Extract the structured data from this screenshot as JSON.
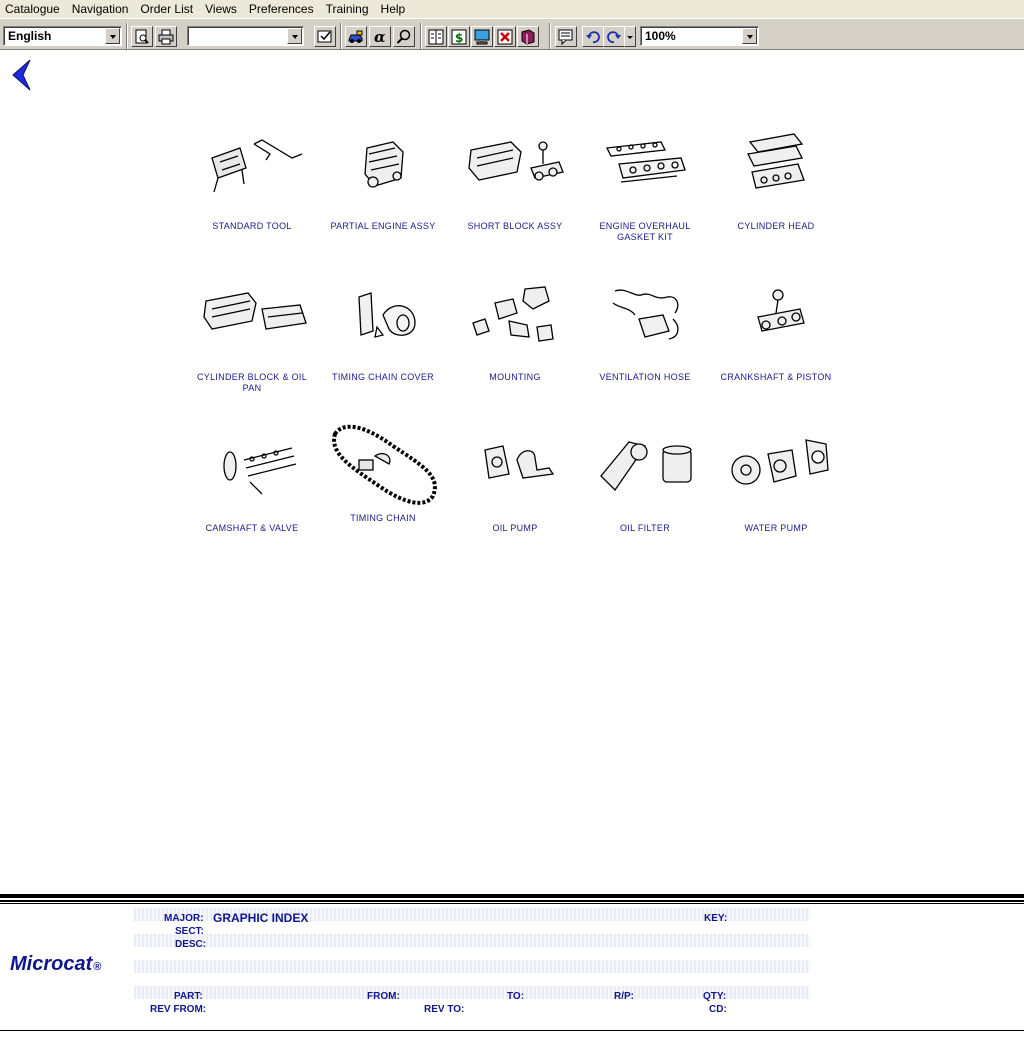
{
  "menu": [
    "Catalogue",
    "Navigation",
    "Order List",
    "Views",
    "Preferences",
    "Training",
    "Help"
  ],
  "toolbar": {
    "language": "English",
    "blank_combo": "",
    "zoom": "100%"
  },
  "grid": [
    {
      "label": "STANDARD TOOL",
      "icon": "standard-tool-icon"
    },
    {
      "label": "PARTIAL ENGINE ASSY",
      "icon": "partial-engine-icon"
    },
    {
      "label": "SHORT BLOCK ASSY",
      "icon": "short-block-icon"
    },
    {
      "label": "ENGINE OVERHAUL GASKET KIT",
      "icon": "gasket-kit-icon"
    },
    {
      "label": "CYLINDER HEAD",
      "icon": "cylinder-head-icon"
    },
    {
      "label": "CYLINDER BLOCK & OIL PAN",
      "icon": "cylinder-block-icon"
    },
    {
      "label": "TIMING CHAIN COVER",
      "icon": "timing-cover-icon"
    },
    {
      "label": "MOUNTING",
      "icon": "mounting-icon"
    },
    {
      "label": "VENTILATION HOSE",
      "icon": "ventilation-hose-icon"
    },
    {
      "label": "CRANKSHAFT & PISTON",
      "icon": "crankshaft-icon"
    },
    {
      "label": "CAMSHAFT & VALVE",
      "icon": "camshaft-icon"
    },
    {
      "label": "TIMING CHAIN",
      "icon": "timing-chain-icon"
    },
    {
      "label": "OIL PUMP",
      "icon": "oil-pump-icon"
    },
    {
      "label": "OIL FILTER",
      "icon": "oil-filter-icon"
    },
    {
      "label": "WATER PUMP",
      "icon": "water-pump-icon"
    }
  ],
  "footer": {
    "logo": "Microcat",
    "logo_mark": "®",
    "labels": {
      "major": "MAJOR:",
      "sect": "SECT:",
      "desc": "DESC:",
      "key": "KEY:",
      "part": "PART:",
      "from": "FROM:",
      "to": "TO:",
      "rp": "R/P:",
      "qty": "QTY:",
      "rev_from": "REV FROM:",
      "rev_to": "REV TO:",
      "cd": "CD:"
    },
    "major_value": "GRAPHIC INDEX"
  }
}
